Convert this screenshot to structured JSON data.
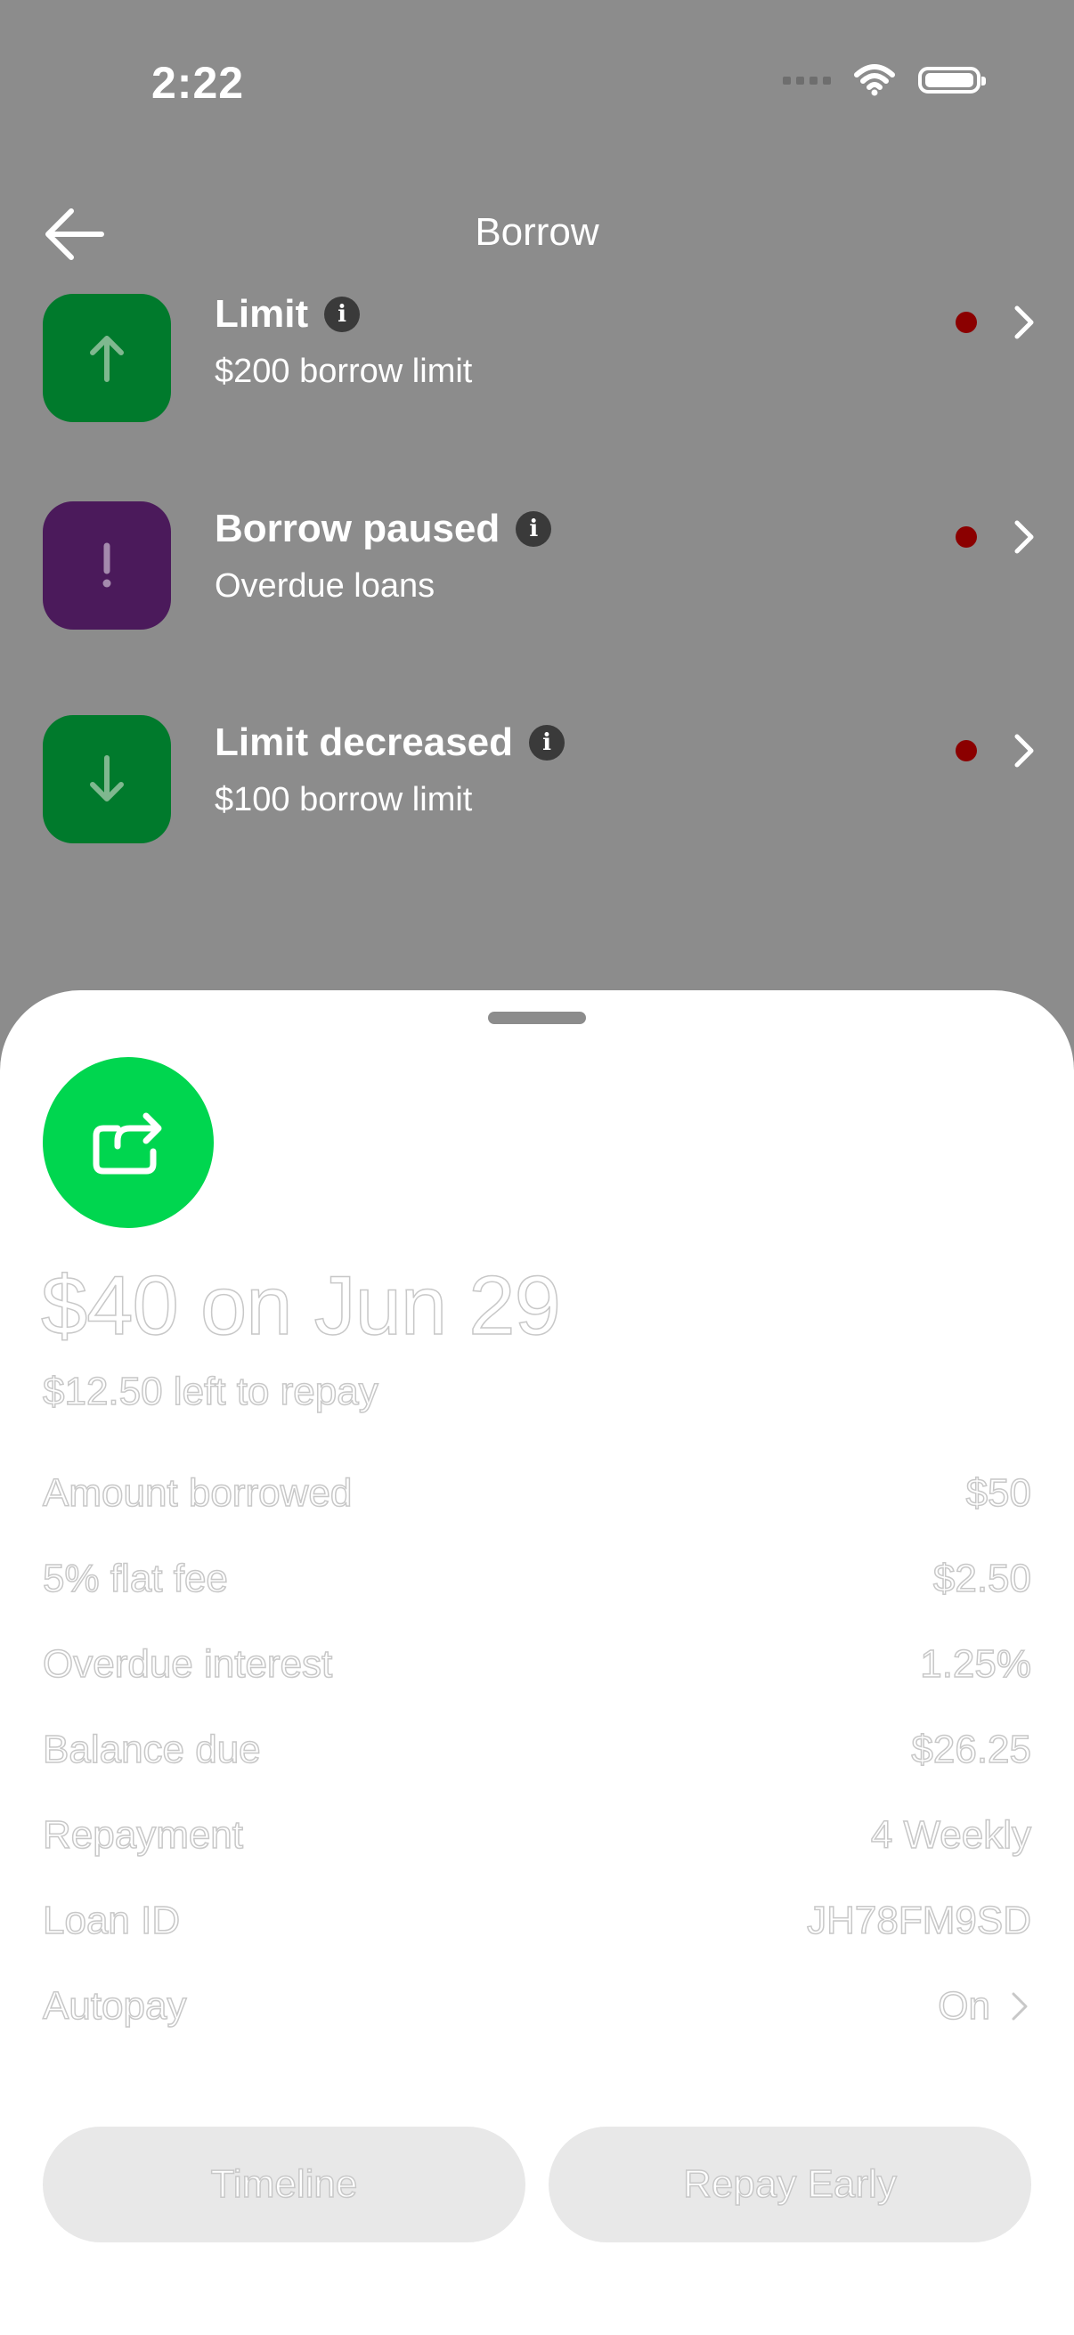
{
  "status_bar": {
    "time": "2:22"
  },
  "header": {
    "title": "Borrow"
  },
  "rows": [
    {
      "title": "Limit",
      "subtitle": "$200 borrow limit",
      "icon": "arrow-up-icon",
      "color": "#007a2c"
    },
    {
      "title": "Borrow paused",
      "subtitle": "Overdue loans",
      "icon": "exclamation-icon",
      "color": "#4b1a5b"
    },
    {
      "title": "Limit decreased",
      "subtitle": "$100 borrow limit",
      "icon": "arrow-down-icon",
      "color": "#007a2c"
    }
  ],
  "loan": {
    "headline": "$40 on Jun 29",
    "subline": "$12.50 left to repay",
    "details": [
      {
        "label": "Amount borrowed",
        "value": "$50"
      },
      {
        "label": "5% flat fee",
        "value": "$2.50"
      },
      {
        "label": "Overdue interest",
        "value": "1.25%"
      },
      {
        "label": "Balance due",
        "value": "$26.25"
      },
      {
        "label": "Repayment",
        "value": "4 Weekly"
      },
      {
        "label": "Loan ID",
        "value": "JH78FM9SD"
      },
      {
        "label": "Autopay",
        "value": "On"
      }
    ]
  },
  "buttons": {
    "timeline": "Timeline",
    "repay_early": "Repay Early"
  },
  "colors": {
    "accent_green": "#00d64f",
    "dot_red": "#8b0000",
    "overlay_gray": "#8c8c8c"
  }
}
